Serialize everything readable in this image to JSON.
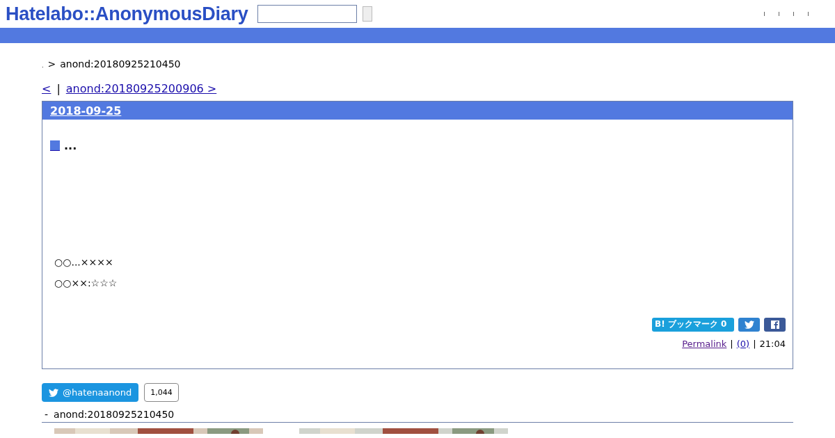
{
  "header": {
    "logo": "Hatelabo::AnonymousDiary"
  },
  "breadcrumb": {
    "dot": ".",
    "separator": ">",
    "current": "anond:20180925210450"
  },
  "pager": {
    "prev": "<",
    "divider": "|",
    "next": "anond:20180925200906 >"
  },
  "day": {
    "date": "2018-09-25",
    "title": "...",
    "lines": [
      "○○...××××",
      "○○××:☆☆☆"
    ],
    "bookmark": "B! ブックマーク 0",
    "permalink": "Permalink",
    "sep1": "|",
    "comments": "(0)",
    "sep2": "|",
    "time": "21:04"
  },
  "follow": {
    "label": "@hatenaanond",
    "count": "1,044"
  },
  "related": {
    "dash": "-",
    "title": "anond:20180925210450"
  }
}
